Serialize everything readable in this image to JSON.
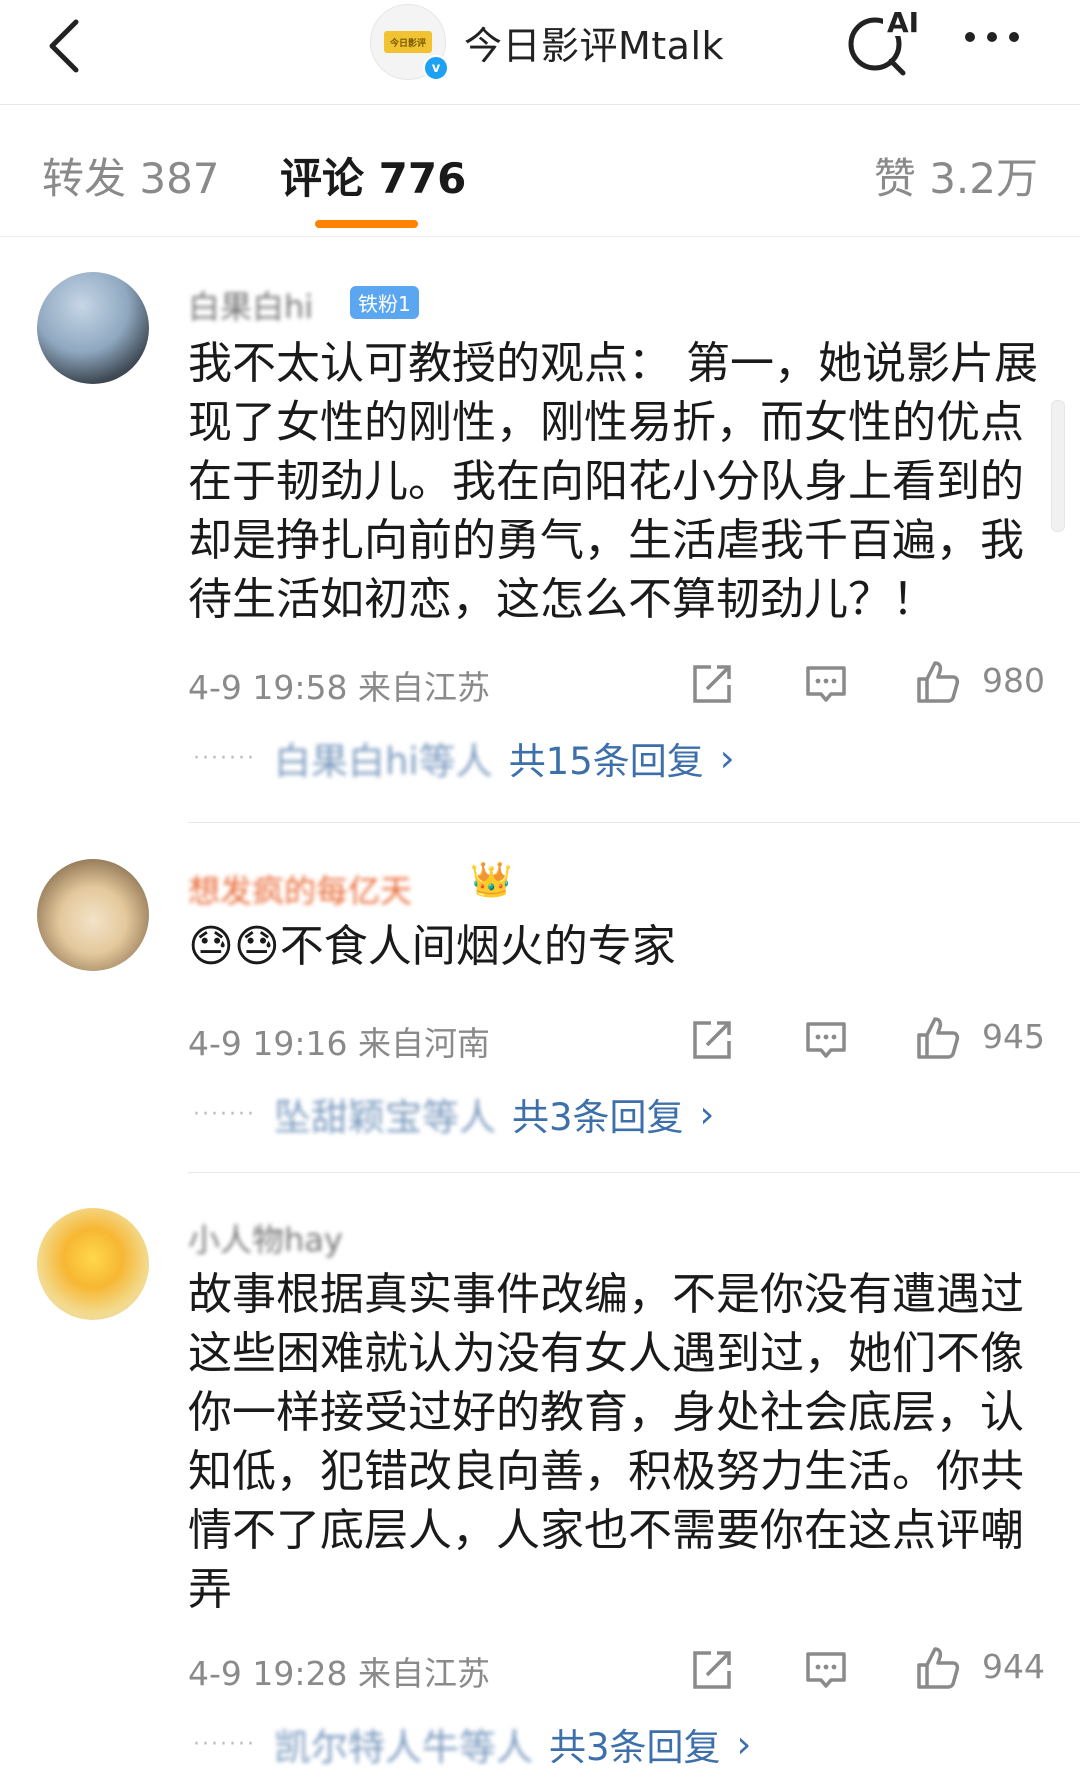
{
  "header": {
    "title": "今日影评Mtalk",
    "logo_text": "今日影评",
    "verified_mark": "v",
    "ai_label": "AI"
  },
  "tabs": {
    "repost": "转发 387",
    "comments": "评论 776",
    "likes": "赞 3.2万"
  },
  "comments": [
    {
      "username": "白果白hi",
      "badge": "铁粉1",
      "text": "我不太认可教授的观点： 第一，她说影片展现了女性的刚性，刚性易折，而女性的优点在于韧劲儿。我在向阳花小分队身上看到的却是挣扎向前的勇气，生活虐我千百遍，我待生活如初恋，这怎么不算韧劲儿？！",
      "meta": "4-9 19:58  来自江苏",
      "likes": "980",
      "reply_dots": "·······",
      "reply_names": "白果白hi等人",
      "reply_count": "共15条回复",
      "reply_chevron": "›"
    },
    {
      "username": "想发疯的每亿天",
      "crown": "👑",
      "text": "😓😓不食人间烟火的专家",
      "meta": "4-9 19:16  来自河南",
      "likes": "945",
      "reply_dots": "·······",
      "reply_names": "坠甜颖宝等人",
      "reply_count": "共3条回复",
      "reply_chevron": "›"
    },
    {
      "username": "小人物hay",
      "text": "故事根据真实事件改编，不是你没有遭遇过这些困难就认为没有女人遇到过，她们不像你一样接受过好的教育，身处社会底层，认知低，犯错改良向善，积极努力生活。你共情不了底层人，人家也不需要你在这点评嘲弄",
      "meta": "4-9 19:28  来自江苏",
      "likes": "944",
      "reply_dots": "·······",
      "reply_names": "凯尔特人牛等人",
      "reply_count": "共3条回复",
      "reply_chevron": "›"
    }
  ]
}
